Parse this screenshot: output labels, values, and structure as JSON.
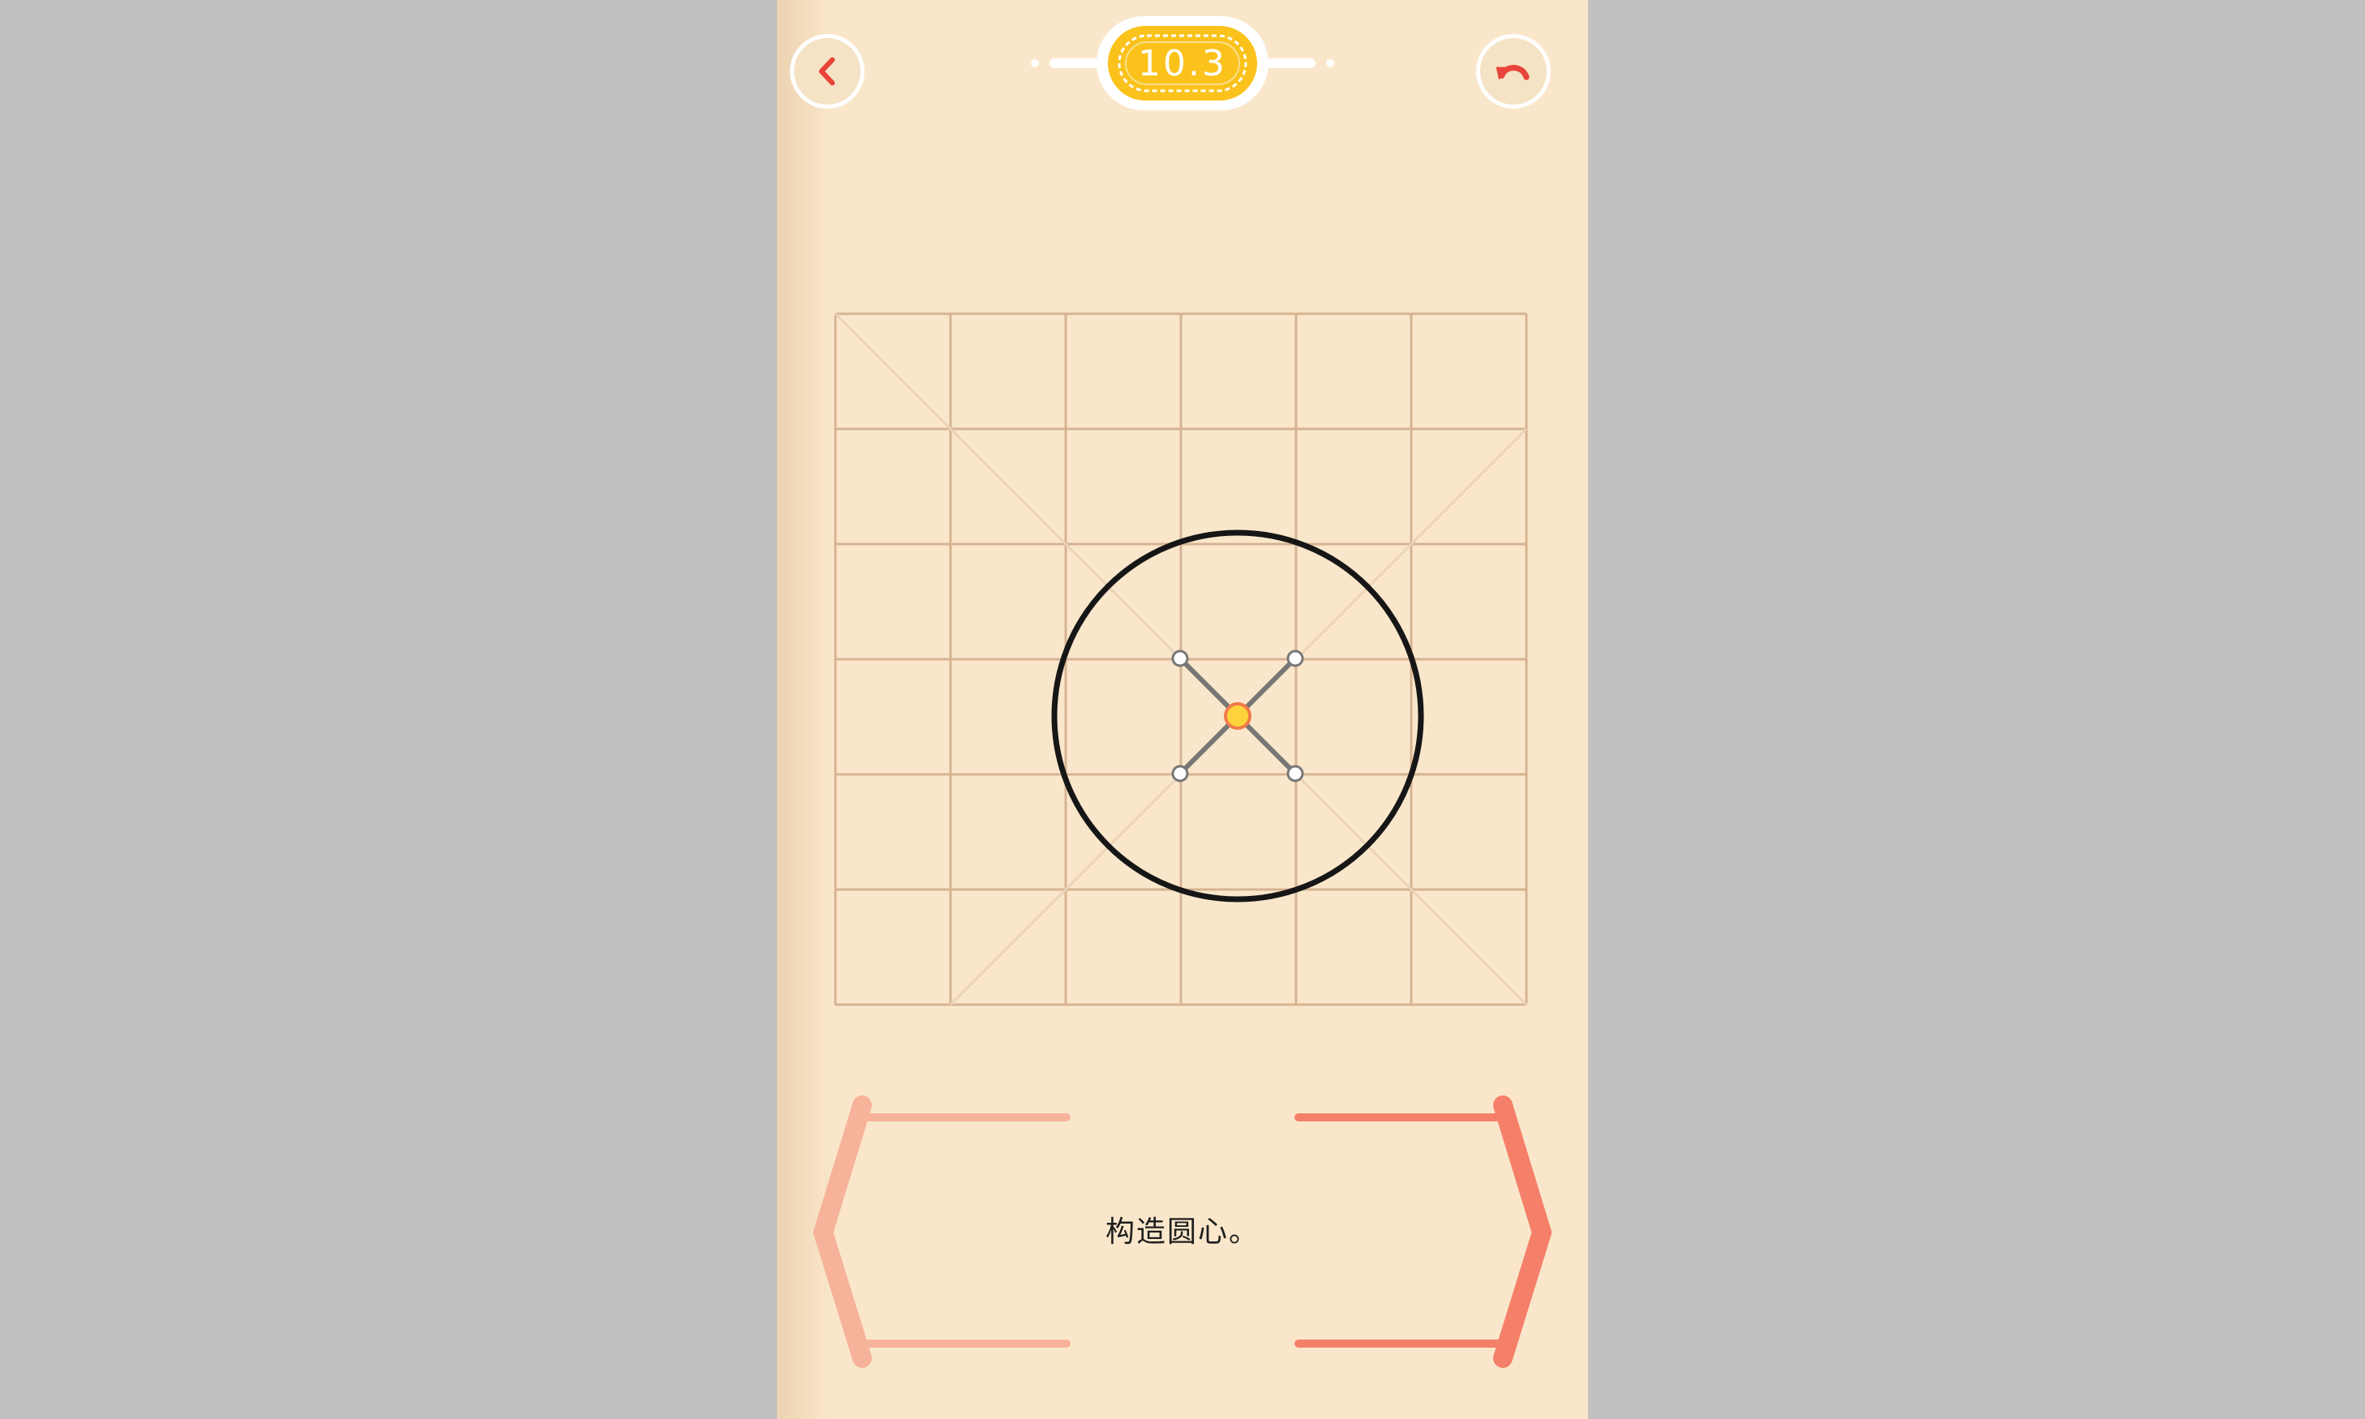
{
  "level": {
    "label": "10.3"
  },
  "hint": {
    "text": "构造圆心。"
  },
  "colors": {
    "page_background": "#c0c0c0",
    "app_background": "#fae7cb",
    "grid_line": "#d6b392",
    "diagonal_line": "#ebd3b8",
    "circle_stroke": "#161616",
    "segment_stroke": "#777777",
    "center_fill": "#fcd33a",
    "center_stroke": "#f07a4a",
    "badge_fill": "#fbc21c",
    "accent_red": "#e8443a",
    "bracket_left": "#f7b29a",
    "bracket_right": "#f5806a"
  },
  "icons": {
    "back": "chevron-left-icon",
    "undo": "undo-arrow-icon"
  }
}
